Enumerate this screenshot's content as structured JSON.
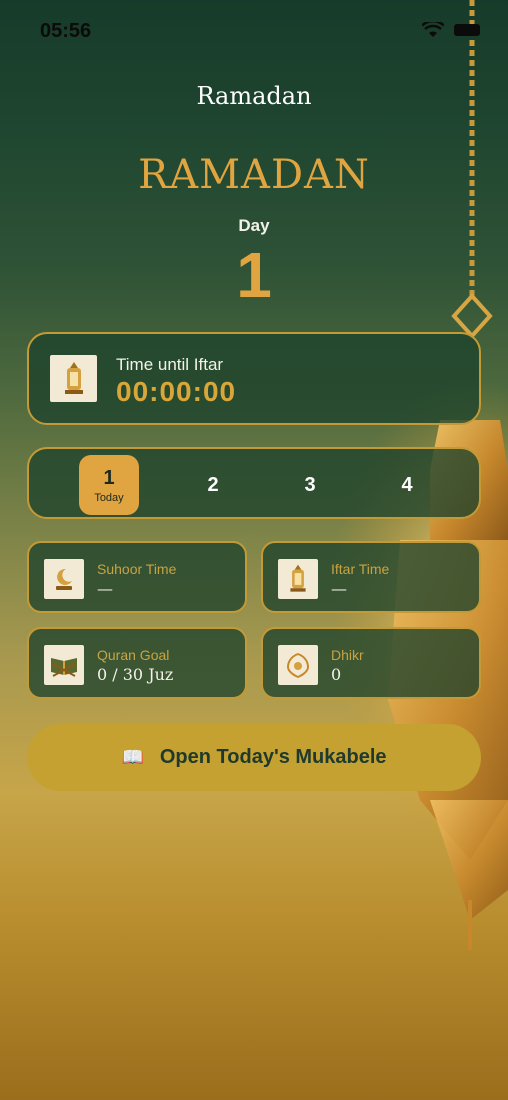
{
  "status_bar": {
    "time": "05:56"
  },
  "header": {
    "app_title": "Ramadan",
    "hero_title": "RAMADAN",
    "day_label": "Day",
    "day_number": "1"
  },
  "iftar_countdown": {
    "label": "Time until Iftar",
    "value": "00:00:00"
  },
  "day_selector": [
    {
      "number": "1",
      "sub": "Today",
      "active": true
    },
    {
      "number": "2"
    },
    {
      "number": "3"
    },
    {
      "number": "4"
    }
  ],
  "stats": {
    "suhoor": {
      "title": "Suhoor Time",
      "value": "—"
    },
    "iftar": {
      "title": "Iftar Time",
      "value": "—"
    },
    "quran": {
      "title": "Quran Goal",
      "value": "0 / 30 Juz"
    },
    "dhikr": {
      "title": "Dhikr",
      "value": "0"
    }
  },
  "cta": {
    "icon": "📖",
    "label": "Open Today's Mukabele"
  },
  "colors": {
    "accent": "#e0a440",
    "card_border": "#c39a36",
    "button": "#c4a131"
  }
}
